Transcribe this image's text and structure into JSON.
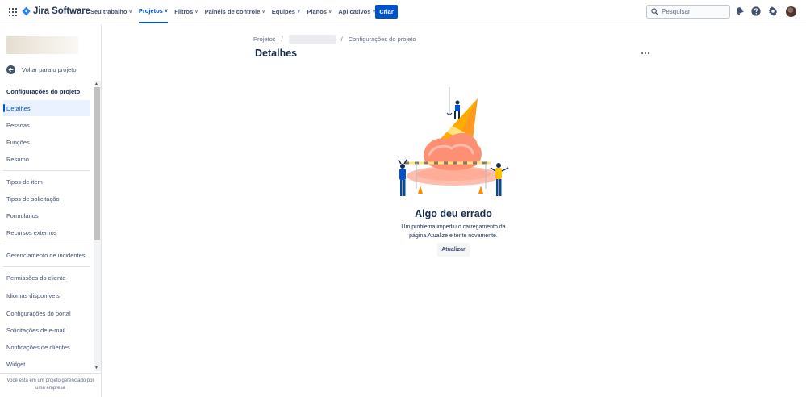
{
  "topnav": {
    "product_name": "Jira Software",
    "items": [
      {
        "label": "Seu trabalho",
        "active": false
      },
      {
        "label": "Projetos",
        "active": true
      },
      {
        "label": "Filtros",
        "active": false
      },
      {
        "label": "Painéis de controle",
        "active": false
      },
      {
        "label": "Equipes",
        "active": false
      },
      {
        "label": "Planos",
        "active": false
      },
      {
        "label": "Aplicativos",
        "active": false
      }
    ],
    "create_label": "Criar",
    "search_placeholder": "Pesquisar",
    "icons": [
      "app-switcher-icon",
      "jira-logo-icon",
      "search-icon",
      "notifications-icon",
      "help-icon",
      "settings-icon",
      "avatar"
    ],
    "accent_color": "#0052cc"
  },
  "sidebar": {
    "back_label": "Voltar para o projeto",
    "section_title": "Configurações do projeto",
    "groups": [
      [
        {
          "label": "Detalhes",
          "active": true
        },
        {
          "label": "Pessoas",
          "active": false
        },
        {
          "label": "Funções",
          "active": false
        },
        {
          "label": "Resumo",
          "active": false
        }
      ],
      [
        {
          "label": "Tipos de item",
          "active": false
        },
        {
          "label": "Tipos de solicitação",
          "active": false
        },
        {
          "label": "Formulários",
          "active": false
        },
        {
          "label": "Recursos externos",
          "active": false
        }
      ],
      [
        {
          "label": "Gerenciamento de incidentes",
          "active": false
        }
      ],
      [
        {
          "label": "Permissões do cliente",
          "active": false
        },
        {
          "label": "Idiomas disponíveis",
          "active": false
        },
        {
          "label": "Configurações do portal",
          "active": false
        },
        {
          "label": "Solicitações de e-mail",
          "active": false
        },
        {
          "label": "Notificações de clientes",
          "active": false
        },
        {
          "label": "Widget",
          "active": false
        }
      ]
    ],
    "footer": "Você está em um projeto gerenciado por uma empresa"
  },
  "main": {
    "breadcrumb": {
      "root": "Projetos",
      "current": "Configurações do projeto"
    },
    "title": "Detalhes",
    "error": {
      "title": "Algo deu errado",
      "message": "Um problema impediu o carregamento da página.Atualize e tente novamente.",
      "button_label": "Atualizar"
    }
  }
}
